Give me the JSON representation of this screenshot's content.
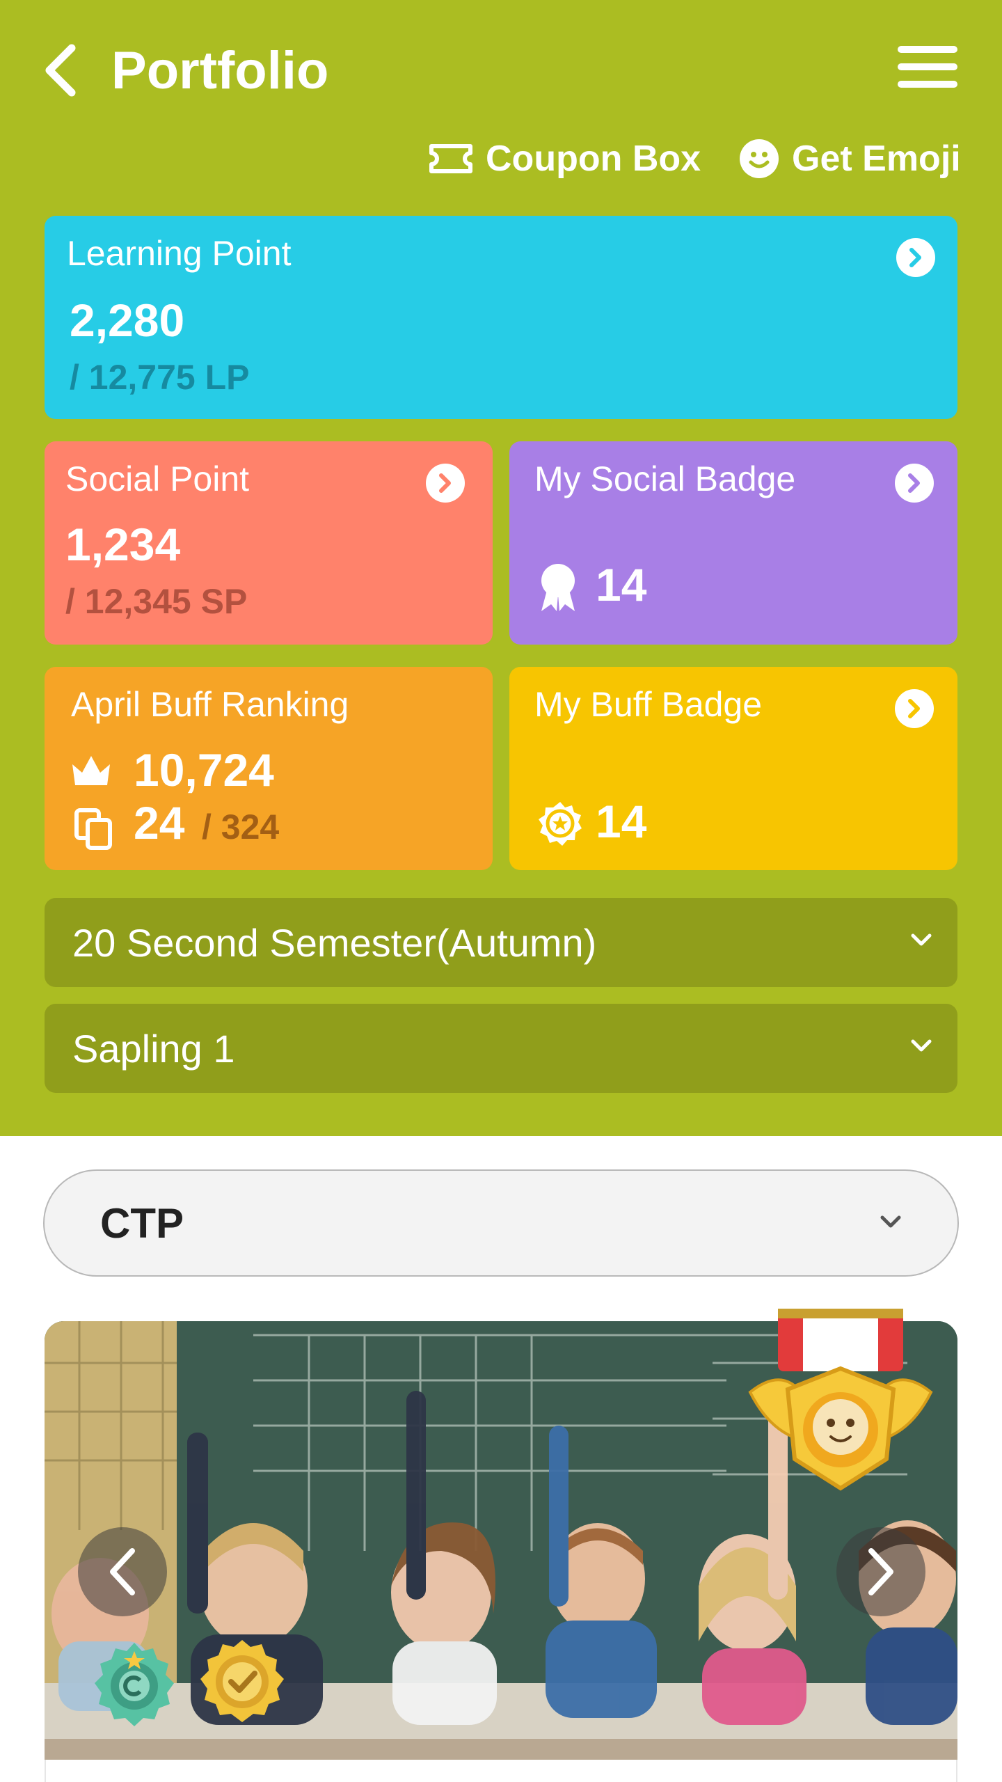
{
  "header": {
    "title": "Portfolio",
    "coupon_label": "Coupon Box",
    "emoji_label": "Get Emoji"
  },
  "learning_point": {
    "label": "Learning Point",
    "value": "2,280",
    "total": "/ 12,775 LP"
  },
  "social_point": {
    "label": "Social Point",
    "value": "1,234",
    "total": "/ 12,345 SP"
  },
  "social_badge": {
    "label": "My Social Badge",
    "count": "14"
  },
  "buff_ranking": {
    "label": "April Buff Ranking",
    "rank": "10,724",
    "count": "24",
    "total": "/ 324"
  },
  "buff_badge": {
    "label": "My Buff Badge",
    "count": "14"
  },
  "filters": {
    "semester": "20 Second Semester(Autumn)",
    "level": "Sapling 1"
  },
  "category": {
    "selected": "CTP"
  },
  "colors": {
    "header_bg": "#abbd22",
    "selector_bg": "#909e1b",
    "learning_card": "#27cce6",
    "social_card": "#ff826b",
    "social_badge_card": "#a87fe6",
    "buff_ranking_card": "#f6a426",
    "buff_badge_card": "#f7c501"
  },
  "icons": {
    "back": "chevron-left-icon",
    "menu": "hamburger-menu-icon",
    "coupon": "ticket-icon",
    "emoji": "smiley-icon",
    "arrow": "chevron-right-circle-icon",
    "social_badge": "ribbon-badge-icon",
    "crown": "crown-icon",
    "copy": "copy-icon",
    "buff_badge": "star-seal-icon"
  }
}
